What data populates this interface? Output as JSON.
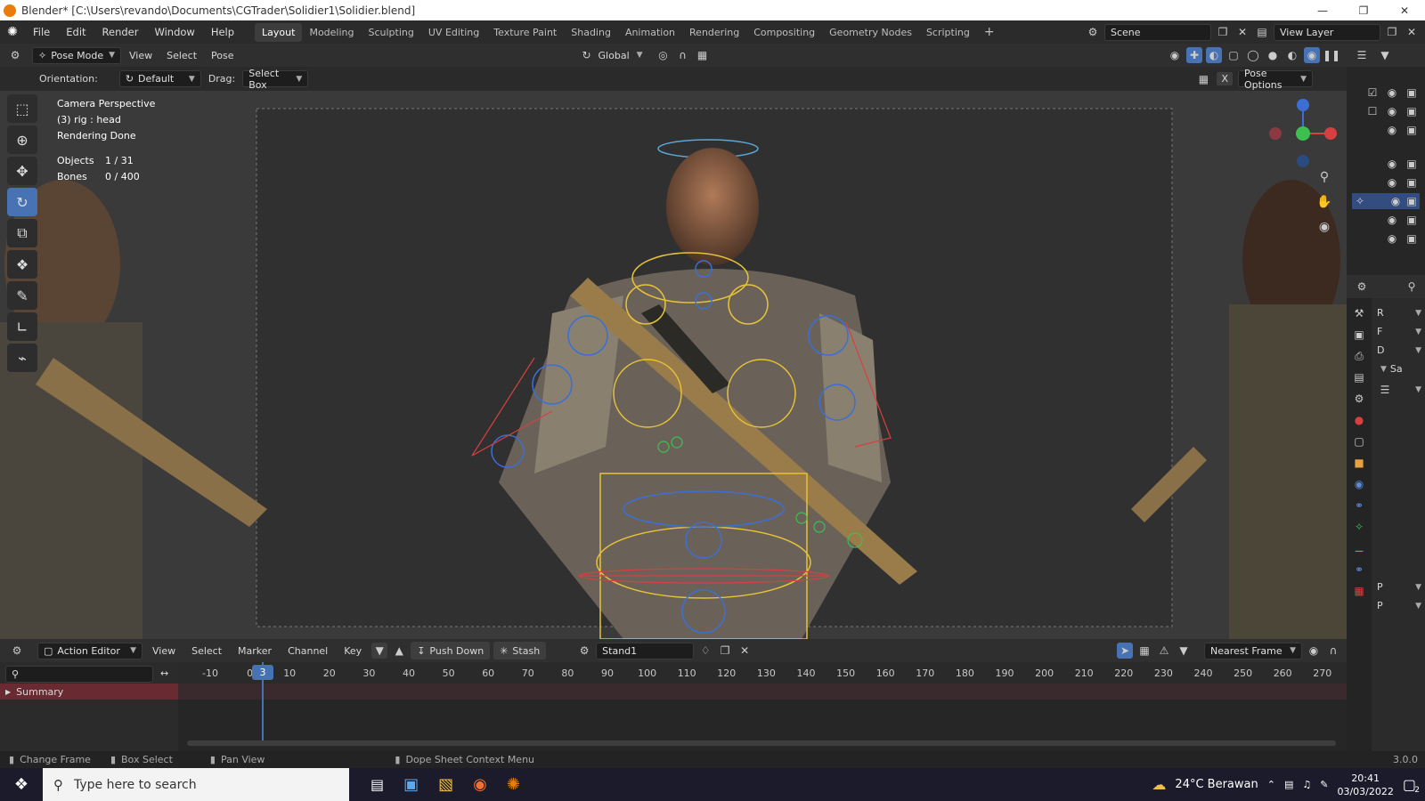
{
  "titlebar": {
    "title": "Blender* [C:\\Users\\revando\\Documents\\CGTrader\\Solidier1\\Solidier.blend]"
  },
  "menus": [
    "File",
    "Edit",
    "Render",
    "Window",
    "Help"
  ],
  "workspaces": [
    "Layout",
    "Modeling",
    "Sculpting",
    "UV Editing",
    "Texture Paint",
    "Shading",
    "Animation",
    "Rendering",
    "Compositing",
    "Geometry Nodes",
    "Scripting"
  ],
  "scene": {
    "label": "Scene"
  },
  "view_layer": {
    "label": "View Layer"
  },
  "header": {
    "mode": "Pose Mode",
    "view": "View",
    "select": "Select",
    "pose": "Pose",
    "transform_orientation": "Global"
  },
  "toolsettings": {
    "orientation_label": "Orientation:",
    "orientation_value": "Default",
    "drag_label": "Drag:",
    "drag_value": "Select Box",
    "pose_options": "Pose Options",
    "x_toggle": "X"
  },
  "overlay": {
    "camera": "Camera Perspective",
    "object": "(3) rig : head",
    "status": "Rendering Done",
    "objects_label": "Objects",
    "objects_value": "1 / 31",
    "bones_label": "Bones",
    "bones_value": "0 / 400"
  },
  "properties_letters": [
    "R",
    "F",
    "D"
  ],
  "properties_extra": "Sa",
  "properties_bottom": [
    "P",
    "P"
  ],
  "dopesheet": {
    "editor": "Action Editor",
    "view": "View",
    "select": "Select",
    "marker": "Marker",
    "channel": "Channel",
    "key": "Key",
    "push_down": "Push Down",
    "stash": "Stash",
    "action": "Stand1",
    "snap": "Nearest Frame",
    "current_frame": "3",
    "summary": "Summary",
    "ticks": [
      "-10",
      "0",
      "10",
      "20",
      "30",
      "40",
      "50",
      "60",
      "70",
      "80",
      "90",
      "100",
      "110",
      "120",
      "130",
      "140",
      "150",
      "160",
      "170",
      "180",
      "190",
      "200",
      "210",
      "220",
      "230",
      "240",
      "250",
      "260",
      "270"
    ]
  },
  "statusbar": {
    "change_frame": "Change Frame",
    "box_select": "Box Select",
    "pan_view": "Pan View",
    "context_menu": "Dope Sheet Context Menu",
    "version": "3.0.0"
  },
  "taskbar": {
    "search_placeholder": "Type here to search",
    "weather": "24°C  Berawan",
    "time": "20:41",
    "date": "03/03/2022",
    "notifications": "2"
  }
}
